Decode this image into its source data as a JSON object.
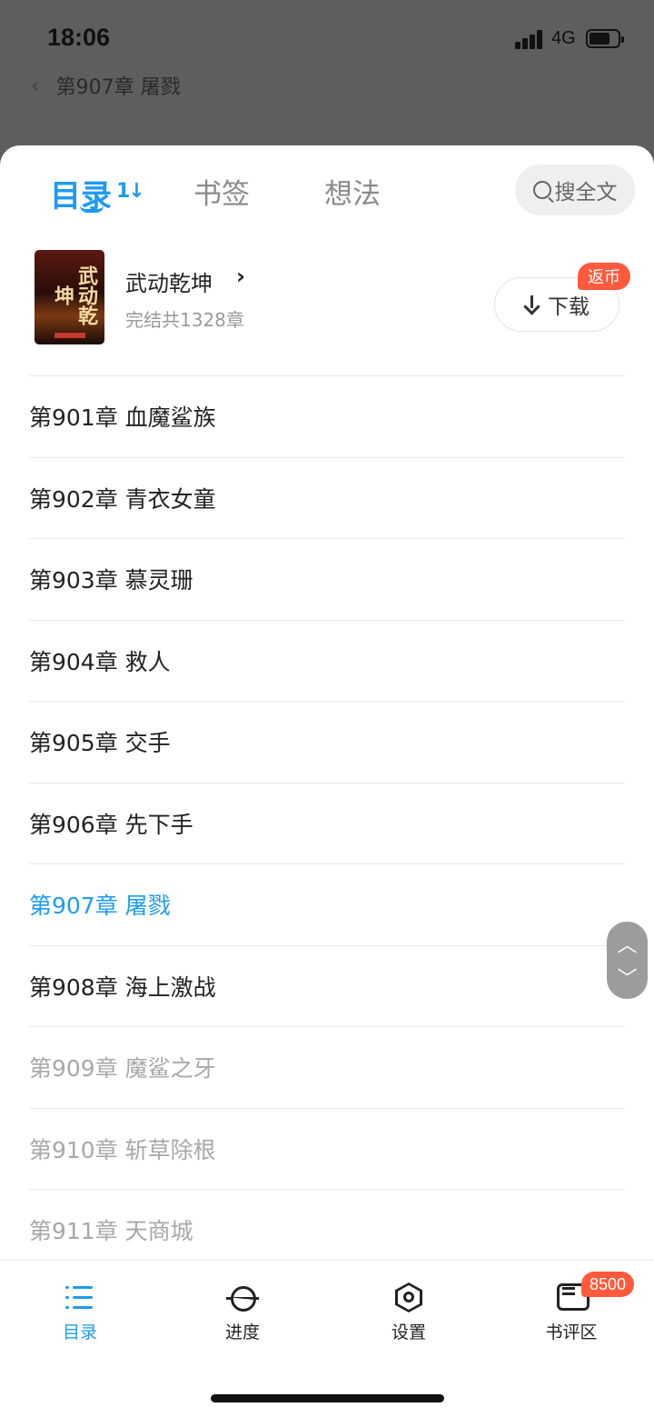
{
  "status_bar": {
    "time": "18:06",
    "network": "4G"
  },
  "reader": {
    "chapter_title": "第907章 屠戮"
  },
  "tabs": [
    {
      "label": "目录"
    },
    {
      "label": "书签"
    },
    {
      "label": "想法"
    }
  ],
  "sort_glyph": "1↓",
  "search": {
    "label": "搜全文"
  },
  "book": {
    "title": "武动乾坤",
    "subtitle": "完结共1328章",
    "cover_text": "武动乾坤",
    "download_label": "下载",
    "refund_badge": "返币"
  },
  "chapters": [
    {
      "title": "第901章  血魔鲨族",
      "state": "normal"
    },
    {
      "title": "第902章  青衣女童",
      "state": "normal"
    },
    {
      "title": "第903章  慕灵珊",
      "state": "normal"
    },
    {
      "title": "第904章  救人",
      "state": "normal"
    },
    {
      "title": "第905章  交手",
      "state": "normal"
    },
    {
      "title": "第906章  先下手",
      "state": "normal"
    },
    {
      "title": "第907章  屠戮",
      "state": "current"
    },
    {
      "title": "第908章  海上激战",
      "state": "normal"
    },
    {
      "title": "第909章  魔鲨之牙",
      "state": "locked"
    },
    {
      "title": "第910章  斩草除根",
      "state": "locked"
    },
    {
      "title": "第911章  天商城",
      "state": "locked"
    }
  ],
  "bottom_nav": {
    "catalog": "目录",
    "progress": "进度",
    "settings": "设置",
    "reviews": "书评区",
    "reviews_badge": "8500"
  },
  "colors": {
    "accent": "#1e9bf0",
    "badge": "#ff5a3c",
    "locked_text": "#a8a8a8"
  }
}
